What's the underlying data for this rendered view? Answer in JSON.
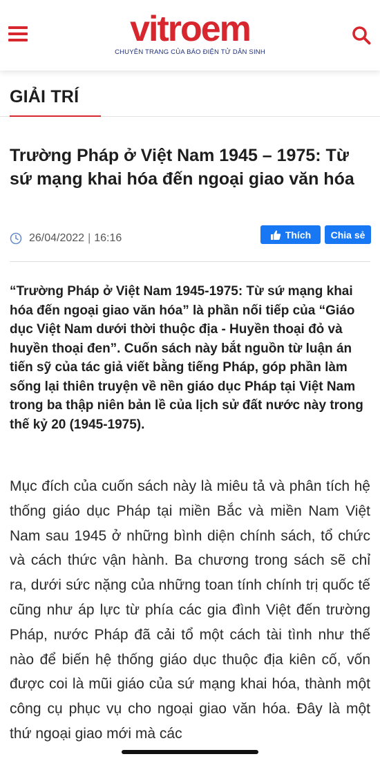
{
  "header": {
    "logo_text": "vitroem",
    "logo_tagline": "CHUYÊN TRANG CỦA BÁO ĐIỆN TỬ DÂN SINH",
    "menu_icon": "hamburger-menu-icon",
    "search_icon": "search-icon"
  },
  "section": {
    "label": "GIẢI TRÍ"
  },
  "article": {
    "title": "Trường Pháp ở Việt Nam 1945 – 1975: Từ sứ mạng khai hóa đến ngoại giao văn hóa",
    "date": "26/04/2022",
    "time": "16:16",
    "like_label": "Thích",
    "share_label": "Chia sẻ",
    "sapo": "“Trường Pháp ở Việt Nam 1945-1975: Từ sứ mạng khai hóa đến ngoại giao văn hóa” là phần nối tiếp của “Giáo dục Việt Nam dưới thời thuộc địa - Huyền thoại đỏ và huyền thoại đen”. Cuốn sách này bắt nguồn từ luận án tiến sỹ của tác giả viết bằng tiếng Pháp, góp phần làm sống lại thiên truyện về nền giáo dục Pháp tại Việt Nam trong ba thập niên bản lề của lịch sử đất nước này trong thế kỷ 20 (1945-1975).",
    "body": "Mục đích của cuốn sách này là miêu tả và phân tích hệ thống giáo dục Pháp tại miền Bắc và miền Nam Việt Nam sau 1945 ở những bình diện chính sách, tổ chức và cách thức vận hành. Ba chương trong sách sẽ chỉ ra, dưới sức nặng của những toan tính chính trị quốc tế cũng như áp lực từ phía các gia đình Việt đến trường Pháp, nước Pháp đã cải tổ một cách tài tình như thế nào để biến hệ thống giáo dục thuộc địa kiên cố, vốn được coi là mũi giáo của sứ mạng khai hóa, thành một công cụ phục vụ cho ngoại giao văn hóa. Đây là một thứ ngoại giao mới mà các"
  },
  "colors": {
    "brand_red": "#d7262e",
    "brand_navy": "#1e2f7a",
    "facebook_blue": "#1877f2"
  }
}
